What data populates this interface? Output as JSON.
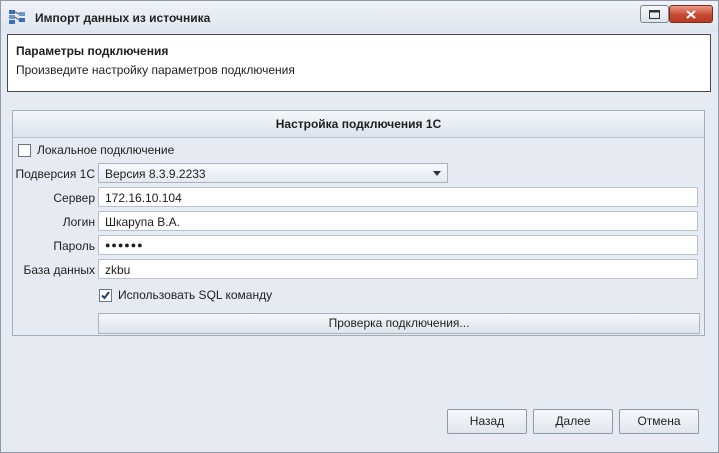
{
  "window": {
    "title": "Импорт данных из источника"
  },
  "header": {
    "title": "Параметры подключения",
    "subtitle": "Произведите настройку параметров подключения"
  },
  "group": {
    "title": "Настройка подключения 1С",
    "local_connection": {
      "label": "Локальное подключение",
      "checked": false
    },
    "subversion": {
      "label": "Подверсия 1С",
      "value": "Версия 8.3.9.2233"
    },
    "server": {
      "label": "Сервер",
      "value": "172.16.10.104"
    },
    "login": {
      "label": "Логин",
      "value": "Шкарупа В.А."
    },
    "password": {
      "label": "Пароль",
      "value": "●●●●●●"
    },
    "database": {
      "label": "База данных",
      "value": "zkbu"
    },
    "use_sql": {
      "label": "Использовать SQL команду",
      "checked": true
    },
    "test_button": "Проверка подключения..."
  },
  "footer": {
    "back": "Назад",
    "next": "Далее",
    "cancel": "Отмена"
  }
}
